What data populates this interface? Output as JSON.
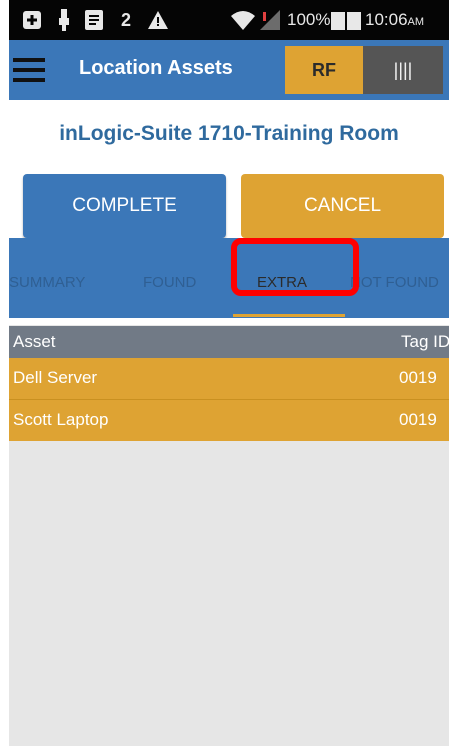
{
  "status_bar": {
    "battery_percent": "100%",
    "time": "10:06",
    "ampm": "AM",
    "icons": [
      "plus-box-icon",
      "usb-icon",
      "message-icon",
      "notification-2-icon",
      "warning-icon",
      "wifi-icon",
      "signal-icon",
      "battery-icon"
    ],
    "notification_count": "2"
  },
  "app_bar": {
    "title": "Location Assets",
    "mode_rf": "RF",
    "mode_barcode": "||||"
  },
  "location": {
    "name": "inLogic-Suite 1710-Training Room"
  },
  "actions": {
    "complete": "COMPLETE",
    "cancel": "CANCEL"
  },
  "tabs": {
    "summary": "SUMMARY",
    "found": "FOUND",
    "extra": "EXTRA",
    "not_found": "NOT FOUND",
    "active": "EXTRA"
  },
  "table": {
    "columns": [
      "Asset",
      "Tag ID"
    ],
    "rows": [
      {
        "asset": "Dell Server",
        "tag": "0019"
      },
      {
        "asset": "Scott Laptop",
        "tag": "0019"
      }
    ]
  },
  "colors": {
    "primary": "#3b77b8",
    "accent": "#dea333",
    "highlight": "#ff0000"
  }
}
